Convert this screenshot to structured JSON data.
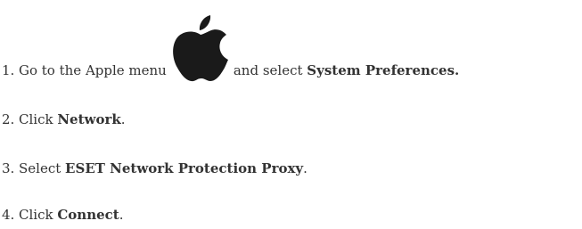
{
  "steps": [
    {
      "number": "1.",
      "prefix": "Go to the Apple menu",
      "middle": "and select",
      "bold": "System Preferences.",
      "suffix": "",
      "icon": "apple-logo-icon"
    },
    {
      "number": "2.",
      "prefix": "Click",
      "bold": "Network",
      "suffix": "."
    },
    {
      "number": "3.",
      "prefix": "Select",
      "bold": "ESET Network Protection Proxy",
      "suffix": "."
    },
    {
      "number": "4.",
      "prefix": "Click",
      "bold": "Connect",
      "suffix": "."
    }
  ],
  "colors": {
    "text": "#333333",
    "icon": "#1a1a1a"
  }
}
